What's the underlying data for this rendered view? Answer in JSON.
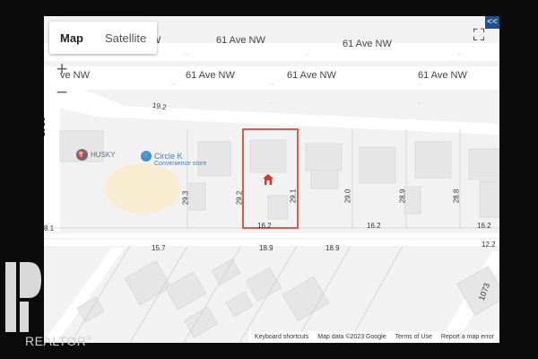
{
  "map": {
    "map_type_options": [
      "Map",
      "Satellite"
    ],
    "selected_map_type": "Map",
    "zoom_in_label": "+",
    "zoom_out_label": "−",
    "fullscreen_icon": "fullscreen-icon",
    "collapse_label": "<<",
    "streets": [
      {
        "name": "61 Ave NW",
        "rendered": [
          "NW",
          "61 Ave NW",
          "61 Ave NW"
        ]
      },
      {
        "name": "61 Ave NW",
        "rendered": [
          "Ave NW",
          "61 Ave NW",
          "61 Ave NW",
          "61 Ave NW"
        ]
      }
    ],
    "top_street_labels": [
      "NW",
      "61 Ave NW",
      "61 Ave NW"
    ],
    "mid_street_labels": [
      "ve NW",
      "61 Ave NW",
      "61 Ave NW",
      "61 Ave NW"
    ],
    "side_label": "0845",
    "pois": [
      {
        "name": "HUSKY",
        "icon": "gas-station-icon"
      },
      {
        "name": "Circle K",
        "subtitle": "Convenience store",
        "icon": "store-icon"
      }
    ],
    "dimensions": [
      "19.2",
      "29.3",
      "29.2",
      "29.1",
      "29.0",
      "28.9",
      "28.8",
      "16.2",
      "16.2",
      "16.2",
      "8.1",
      "15.7",
      "18.9",
      "18.9",
      "12.2",
      "1073"
    ],
    "selected_lot_icon": "home-icon",
    "selected_lot_color": "#d9362b",
    "attribution": [
      "Keyboard shortcuts",
      "Map data ©2023 Google",
      "Terms of Use",
      "Report a map error"
    ]
  },
  "watermark": {
    "text": "REALTOR",
    "registered": "®"
  }
}
